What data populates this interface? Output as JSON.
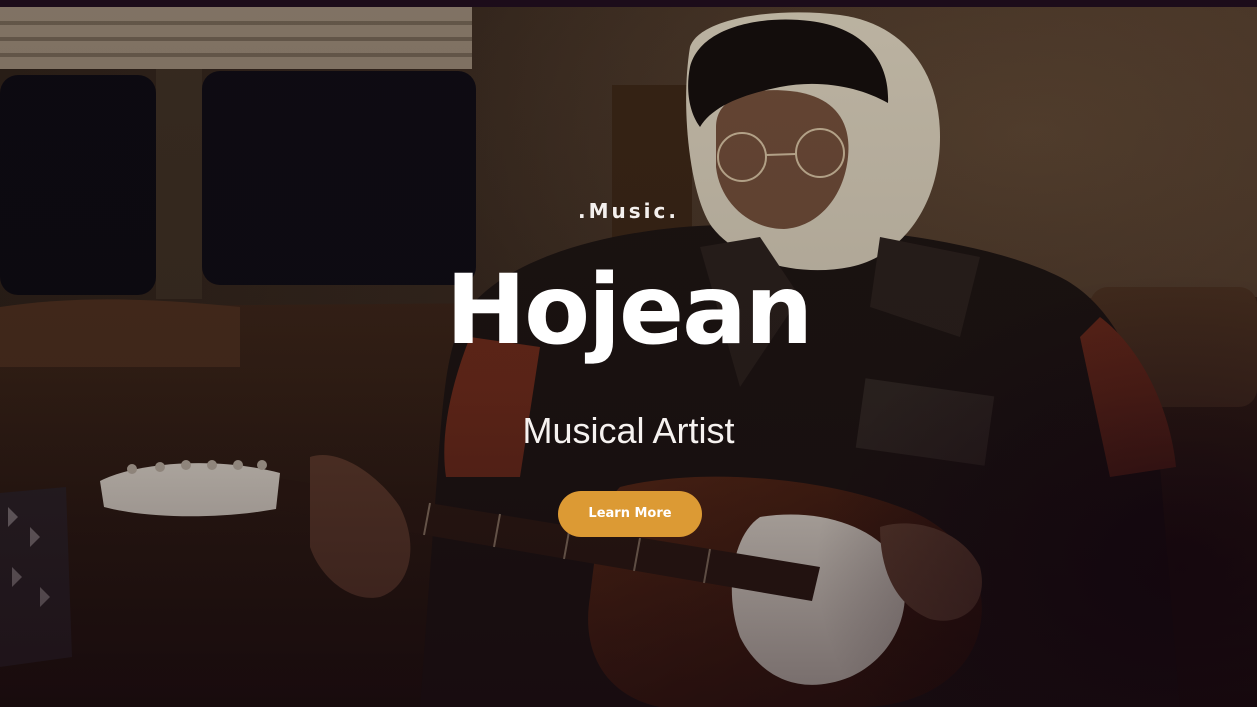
{
  "hero": {
    "eyebrow": ".Music.",
    "title": "Hojean",
    "subtitle": "Musical Artist",
    "cta_label": "Learn More"
  },
  "colors": {
    "accent": "#dc9a34",
    "text": "#ffffff",
    "topbar": "#1c0c1a"
  }
}
